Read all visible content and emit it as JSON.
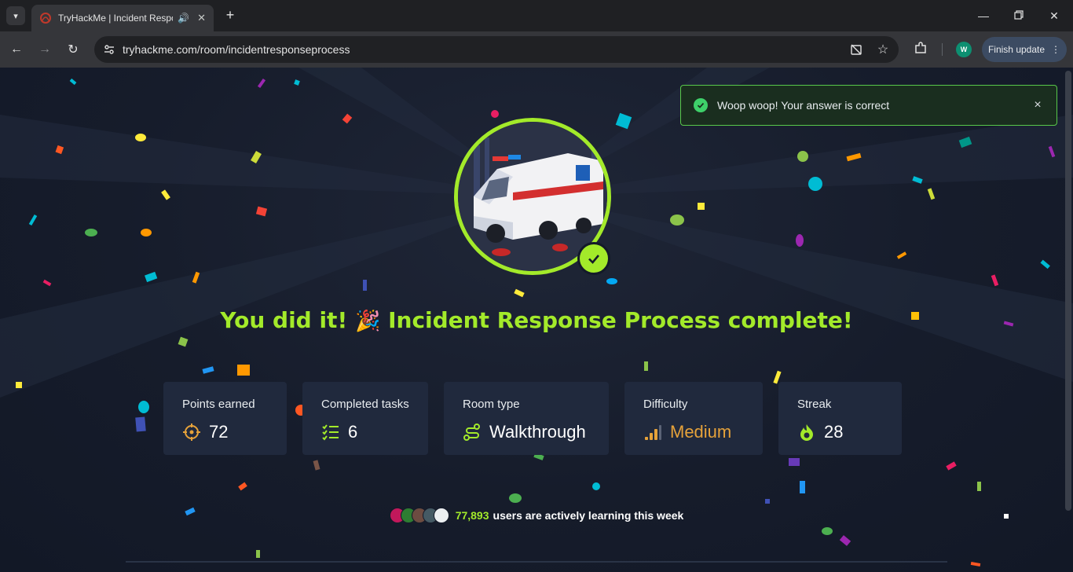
{
  "browser": {
    "tab_title": "TryHackMe | Incident Response Process",
    "url": "tryhackme.com/room/incidentresponseprocess",
    "profile_initial": "W",
    "finish_update_label": "Finish update"
  },
  "toast": {
    "message": "Woop woop! Your answer is correct",
    "close_symbol": "×"
  },
  "headline": {
    "before": "You did it!",
    "emoji": "🎉",
    "after": "Incident Response Process complete!"
  },
  "stats": {
    "points": {
      "label": "Points earned",
      "value": "72",
      "icon": "target-icon"
    },
    "tasks": {
      "label": "Completed tasks",
      "value": "6",
      "icon": "checklist-icon"
    },
    "room_type": {
      "label": "Room type",
      "value": "Walkthrough",
      "icon": "route-icon"
    },
    "difficulty": {
      "label": "Difficulty",
      "value": "Medium",
      "icon": "signal-bars-icon"
    },
    "streak": {
      "label": "Streak",
      "value": "28",
      "icon": "flame-icon"
    }
  },
  "learners": {
    "count": "77,893",
    "text": "users are actively learning this week"
  },
  "colors": {
    "accent_green": "#a3ea2a",
    "page_bg": "#141a29",
    "card_bg": "#20293d",
    "medium_orange": "#e6a23a",
    "toast_border": "#58c84a"
  }
}
